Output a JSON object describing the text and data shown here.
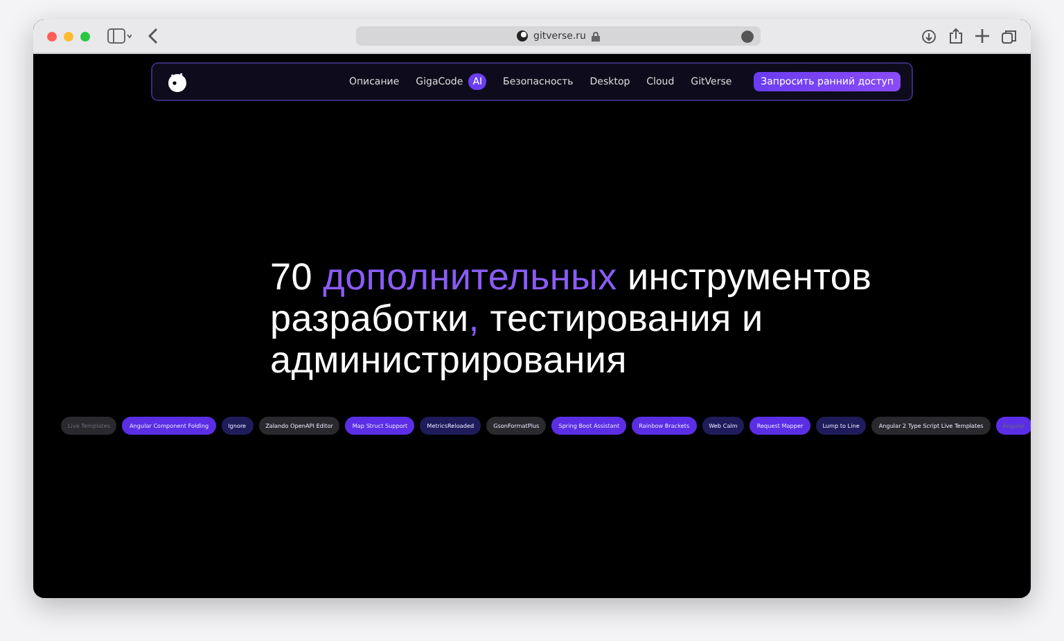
{
  "browser": {
    "url": "gitverse.ru"
  },
  "nav": {
    "items": [
      {
        "label": "Описание"
      },
      {
        "label": "GigaCode",
        "badge": "AI"
      },
      {
        "label": "Безопасность"
      },
      {
        "label": "Desktop"
      },
      {
        "label": "Cloud"
      },
      {
        "label": "GitVerse"
      }
    ],
    "cta": "Запросить ранний доступ"
  },
  "headline": [
    {
      "text": "70 ",
      "accent": false
    },
    {
      "text": "дополнительных",
      "accent": true
    },
    {
      "text": " инструментов разработки",
      "accent": false
    },
    {
      "text": ",",
      "accent": true
    },
    {
      "text": " тестирования и администрирования",
      "accent": false
    }
  ],
  "chips": [
    {
      "label": "Live Templates",
      "color": "#2a2a2e",
      "faded": true
    },
    {
      "label": "Angular Component Folding",
      "color": "#5b2ee6",
      "faded": false
    },
    {
      "label": "Ignore",
      "color": "#1e1c5a",
      "faded": false
    },
    {
      "label": "Zalando OpenAPI Editor",
      "color": "#2a2a2e",
      "faded": false
    },
    {
      "label": "Map Struct Support",
      "color": "#5b2ee6",
      "faded": false
    },
    {
      "label": "MetricsReloaded",
      "color": "#1e1c5a",
      "faded": false
    },
    {
      "label": "GsonFormatPlus",
      "color": "#2a2a2e",
      "faded": false
    },
    {
      "label": "Spring Boot Assistant",
      "color": "#5b2ee6",
      "faded": false
    },
    {
      "label": "Rainbow Brackets",
      "color": "#5b2ee6",
      "faded": false
    },
    {
      "label": "Web Calm",
      "color": "#1e1c5a",
      "faded": false
    },
    {
      "label": "Request Mapper",
      "color": "#5b2ee6",
      "faded": false
    },
    {
      "label": "Lump to Line",
      "color": "#1e1c5a",
      "faded": false
    },
    {
      "label": "Angular 2 Type Script Live Templates",
      "color": "#2a2a2e",
      "faded": false
    },
    {
      "label": "Angular",
      "color": "#5b2ee6",
      "faded": true
    }
  ]
}
